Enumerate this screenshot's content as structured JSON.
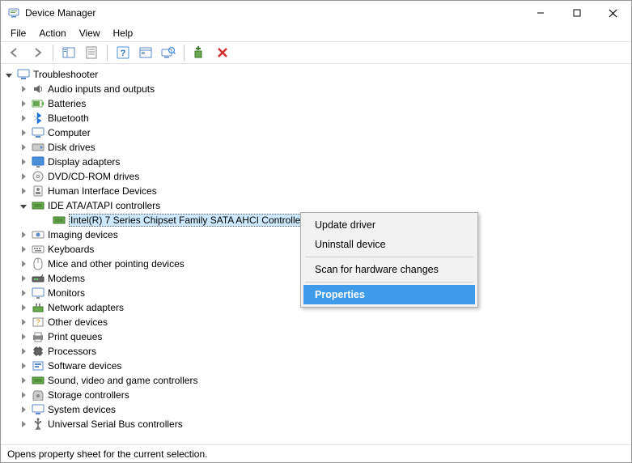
{
  "window": {
    "title": "Device Manager"
  },
  "menu": {
    "file": "File",
    "action": "Action",
    "view": "View",
    "help": "Help"
  },
  "tree": {
    "root": "Troubleshooter",
    "categories": [
      "Audio inputs and outputs",
      "Batteries",
      "Bluetooth",
      "Computer",
      "Disk drives",
      "Display adapters",
      "DVD/CD-ROM drives",
      "Human Interface Devices",
      "IDE ATA/ATAPI controllers",
      "Imaging devices",
      "Keyboards",
      "Mice and other pointing devices",
      "Modems",
      "Monitors",
      "Network adapters",
      "Other devices",
      "Print queues",
      "Processors",
      "Software devices",
      "Sound, video and game controllers",
      "Storage controllers",
      "System devices",
      "Universal Serial Bus controllers"
    ],
    "selected_device": "Intel(R) 7 Series Chipset Family SATA AHCI Controller"
  },
  "context_menu": {
    "update": "Update driver",
    "uninstall": "Uninstall device",
    "scan": "Scan for hardware changes",
    "properties": "Properties"
  },
  "status": "Opens property sheet for the current selection."
}
